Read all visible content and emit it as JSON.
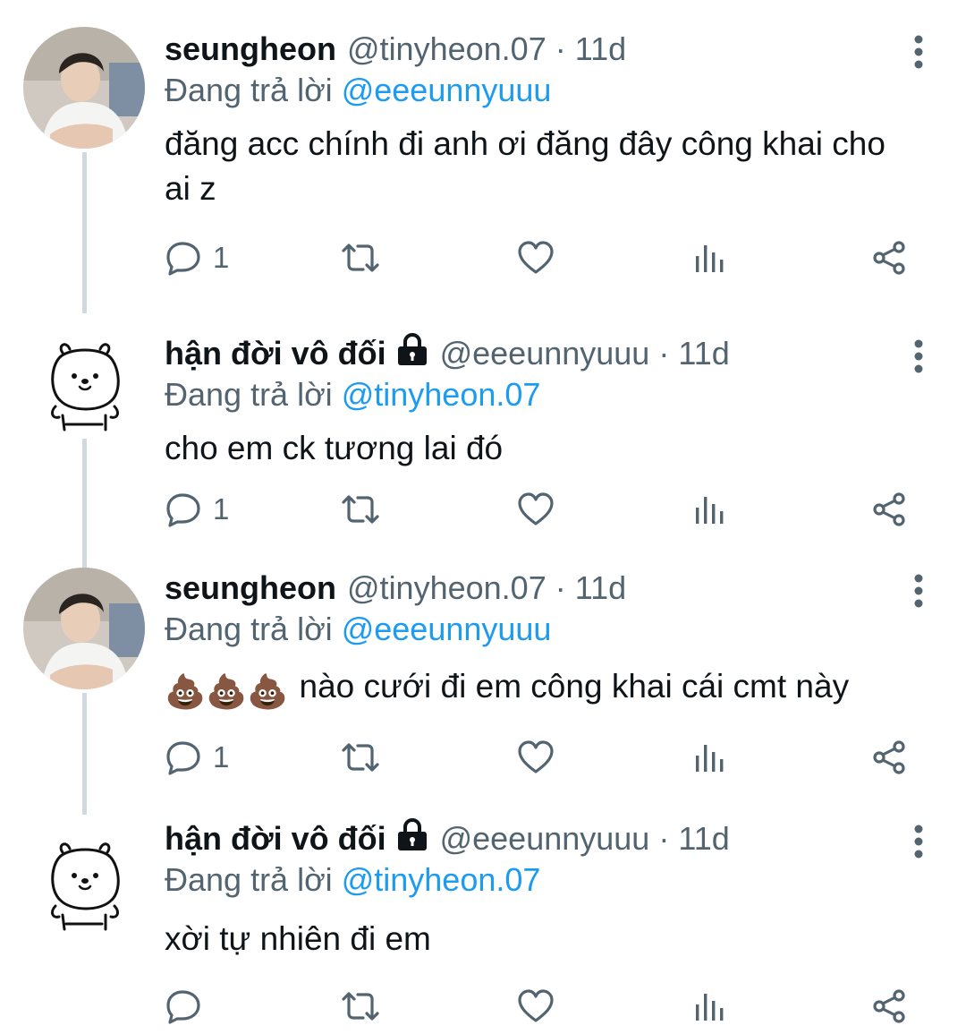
{
  "reply_prefix": "Đang trả lời",
  "tweets": [
    {
      "name": "seungheon",
      "handle": "@tinyheon.07",
      "separator": "·",
      "time": "11d",
      "reply_to": "@eeeunnyuuu",
      "body": "đăng acc chính đi anh ơi đăng đây công khai cho ai z",
      "reply_count": "1",
      "avatar": "photo"
    },
    {
      "name": "hận đời vô đối",
      "handle": "@eeeunnyuuu",
      "separator": "·",
      "time": "11d",
      "reply_to": "@tinyheon.07",
      "body": "cho em ck tương lai đó",
      "reply_count": "1",
      "avatar": "bear",
      "protected": true
    },
    {
      "name": "seungheon",
      "handle": "@tinyheon.07",
      "separator": "·",
      "time": "11d",
      "reply_to": "@eeeunnyuuu",
      "body_emoji": "💩💩💩",
      "body": "nào cưới đi em công khai cái cmt này",
      "reply_count": "1",
      "avatar": "photo"
    },
    {
      "name": "hận đời vô đối",
      "handle": "@eeeunnyuuu",
      "separator": "·",
      "time": "11d",
      "reply_to": "@tinyheon.07",
      "body": "xời tự nhiên đi em",
      "reply_count": "",
      "avatar": "bear",
      "protected": true
    }
  ],
  "icons": {
    "reply": "reply-icon",
    "retweet": "retweet-icon",
    "like": "heart-icon",
    "stats": "stats-icon",
    "share": "share-icon",
    "more": "more-vertical-icon",
    "lock": "lock-icon"
  },
  "colors": {
    "text": "#0f1419",
    "muted": "#536471",
    "mention": "#1d9bf0",
    "thread_line": "#cfd9de"
  }
}
